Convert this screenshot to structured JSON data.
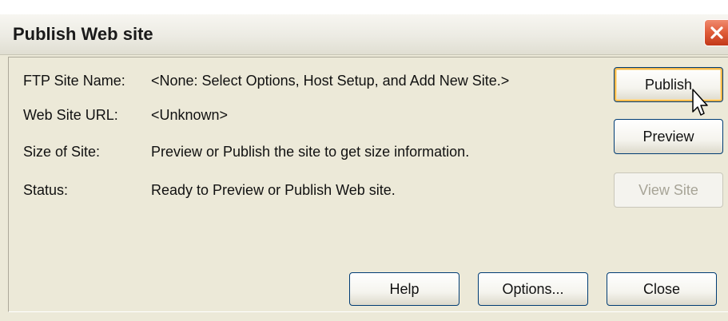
{
  "window": {
    "title": "Publish Web site"
  },
  "info": {
    "ftp_label": "FTP Site Name:",
    "ftp_value": "<None: Select Options, Host Setup, and Add New Site.>",
    "url_label": "Web Site URL:",
    "url_value": "<Unknown>",
    "size_label": "Size of Site:",
    "size_value": "Preview or Publish the site to get size information.",
    "status_label": "Status:",
    "status_value": "Ready to Preview or Publish Web site."
  },
  "buttons": {
    "publish": "Publish",
    "preview": "Preview",
    "view_site": "View Site",
    "help": "Help",
    "options": "Options...",
    "close": "Close"
  },
  "colors": {
    "close_button": "#df5b38",
    "default_button_highlight": "#f5b84a",
    "dialog_background": "#ece9d8"
  },
  "icons": {
    "close": "close-icon",
    "cursor": "mouse-pointer-icon"
  }
}
